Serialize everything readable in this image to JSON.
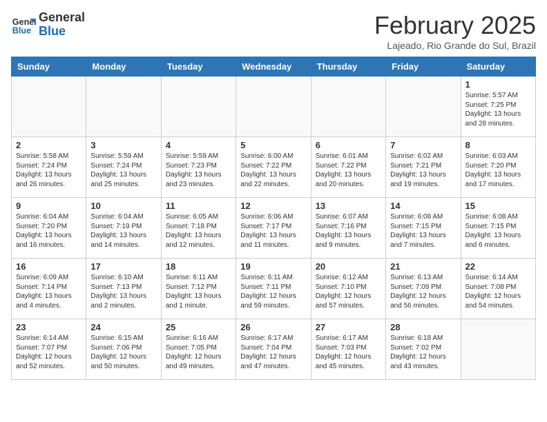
{
  "header": {
    "logo_general": "General",
    "logo_blue": "Blue",
    "month_title": "February 2025",
    "location": "Lajeado, Rio Grande do Sul, Brazil"
  },
  "days_of_week": [
    "Sunday",
    "Monday",
    "Tuesday",
    "Wednesday",
    "Thursday",
    "Friday",
    "Saturday"
  ],
  "weeks": [
    [
      {
        "day": "",
        "info": ""
      },
      {
        "day": "",
        "info": ""
      },
      {
        "day": "",
        "info": ""
      },
      {
        "day": "",
        "info": ""
      },
      {
        "day": "",
        "info": ""
      },
      {
        "day": "",
        "info": ""
      },
      {
        "day": "1",
        "info": "Sunrise: 5:57 AM\nSunset: 7:25 PM\nDaylight: 13 hours and 28 minutes."
      }
    ],
    [
      {
        "day": "2",
        "info": "Sunrise: 5:58 AM\nSunset: 7:24 PM\nDaylight: 13 hours and 26 minutes."
      },
      {
        "day": "3",
        "info": "Sunrise: 5:59 AM\nSunset: 7:24 PM\nDaylight: 13 hours and 25 minutes."
      },
      {
        "day": "4",
        "info": "Sunrise: 5:59 AM\nSunset: 7:23 PM\nDaylight: 13 hours and 23 minutes."
      },
      {
        "day": "5",
        "info": "Sunrise: 6:00 AM\nSunset: 7:22 PM\nDaylight: 13 hours and 22 minutes."
      },
      {
        "day": "6",
        "info": "Sunrise: 6:01 AM\nSunset: 7:22 PM\nDaylight: 13 hours and 20 minutes."
      },
      {
        "day": "7",
        "info": "Sunrise: 6:02 AM\nSunset: 7:21 PM\nDaylight: 13 hours and 19 minutes."
      },
      {
        "day": "8",
        "info": "Sunrise: 6:03 AM\nSunset: 7:20 PM\nDaylight: 13 hours and 17 minutes."
      }
    ],
    [
      {
        "day": "9",
        "info": "Sunrise: 6:04 AM\nSunset: 7:20 PM\nDaylight: 13 hours and 16 minutes."
      },
      {
        "day": "10",
        "info": "Sunrise: 6:04 AM\nSunset: 7:19 PM\nDaylight: 13 hours and 14 minutes."
      },
      {
        "day": "11",
        "info": "Sunrise: 6:05 AM\nSunset: 7:18 PM\nDaylight: 13 hours and 12 minutes."
      },
      {
        "day": "12",
        "info": "Sunrise: 6:06 AM\nSunset: 7:17 PM\nDaylight: 13 hours and 11 minutes."
      },
      {
        "day": "13",
        "info": "Sunrise: 6:07 AM\nSunset: 7:16 PM\nDaylight: 13 hours and 9 minutes."
      },
      {
        "day": "14",
        "info": "Sunrise: 6:08 AM\nSunset: 7:15 PM\nDaylight: 13 hours and 7 minutes."
      },
      {
        "day": "15",
        "info": "Sunrise: 6:08 AM\nSunset: 7:15 PM\nDaylight: 13 hours and 6 minutes."
      }
    ],
    [
      {
        "day": "16",
        "info": "Sunrise: 6:09 AM\nSunset: 7:14 PM\nDaylight: 13 hours and 4 minutes."
      },
      {
        "day": "17",
        "info": "Sunrise: 6:10 AM\nSunset: 7:13 PM\nDaylight: 13 hours and 2 minutes."
      },
      {
        "day": "18",
        "info": "Sunrise: 6:11 AM\nSunset: 7:12 PM\nDaylight: 13 hours and 1 minute."
      },
      {
        "day": "19",
        "info": "Sunrise: 6:11 AM\nSunset: 7:11 PM\nDaylight: 12 hours and 59 minutes."
      },
      {
        "day": "20",
        "info": "Sunrise: 6:12 AM\nSunset: 7:10 PM\nDaylight: 12 hours and 57 minutes."
      },
      {
        "day": "21",
        "info": "Sunrise: 6:13 AM\nSunset: 7:09 PM\nDaylight: 12 hours and 56 minutes."
      },
      {
        "day": "22",
        "info": "Sunrise: 6:14 AM\nSunset: 7:08 PM\nDaylight: 12 hours and 54 minutes."
      }
    ],
    [
      {
        "day": "23",
        "info": "Sunrise: 6:14 AM\nSunset: 7:07 PM\nDaylight: 12 hours and 52 minutes."
      },
      {
        "day": "24",
        "info": "Sunrise: 6:15 AM\nSunset: 7:06 PM\nDaylight: 12 hours and 50 minutes."
      },
      {
        "day": "25",
        "info": "Sunrise: 6:16 AM\nSunset: 7:05 PM\nDaylight: 12 hours and 49 minutes."
      },
      {
        "day": "26",
        "info": "Sunrise: 6:17 AM\nSunset: 7:04 PM\nDaylight: 12 hours and 47 minutes."
      },
      {
        "day": "27",
        "info": "Sunrise: 6:17 AM\nSunset: 7:03 PM\nDaylight: 12 hours and 45 minutes."
      },
      {
        "day": "28",
        "info": "Sunrise: 6:18 AM\nSunset: 7:02 PM\nDaylight: 12 hours and 43 minutes."
      },
      {
        "day": "",
        "info": ""
      }
    ]
  ]
}
